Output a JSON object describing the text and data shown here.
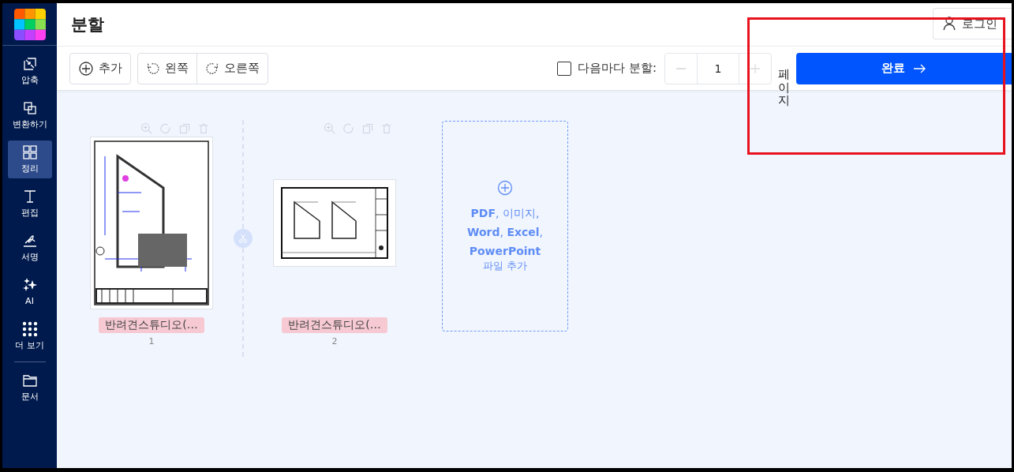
{
  "sidebar": {
    "items": [
      {
        "label": "압축",
        "selected": false
      },
      {
        "label": "변환하기",
        "selected": false
      },
      {
        "label": "정리",
        "selected": true
      },
      {
        "label": "편집",
        "selected": false
      },
      {
        "label": "서명",
        "selected": false
      },
      {
        "label": "AI",
        "selected": false
      },
      {
        "label": "더 보기",
        "selected": false
      }
    ],
    "bottom_items": [
      {
        "label": "문서",
        "selected": false
      }
    ]
  },
  "header": {
    "title": "분할",
    "login": "로그인"
  },
  "toolbar": {
    "add": "추가",
    "rotate_left": "왼쪽",
    "rotate_right": "오른쪽",
    "split_every": {
      "label": "다음마다 분할:",
      "checked": false
    },
    "stepper": {
      "value": "1"
    },
    "unit": "페이지",
    "done": "완료"
  },
  "pages": [
    {
      "name": "반려견스튜디오(…",
      "number": "1",
      "kind": "portrait"
    },
    {
      "name": "반려견스튜디오(…",
      "number": "2",
      "kind": "landscape"
    }
  ],
  "add_card": {
    "types": "**PDF**, 이미지, **Word**, **Excel**, **PowerPoint**",
    "label": "파일 추가"
  }
}
